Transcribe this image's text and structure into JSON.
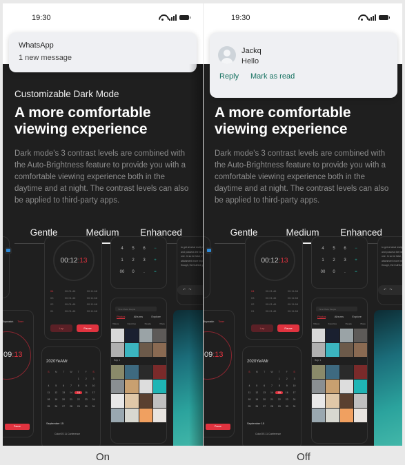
{
  "panels": [
    {
      "id": "on",
      "caption": "On",
      "status_bar": {
        "time": "19:30",
        "icons": [
          "wifi-icon",
          "signal-icon",
          "battery-icon"
        ]
      },
      "notification": {
        "app": "WhatsApp",
        "message": "1 new message"
      }
    },
    {
      "id": "off",
      "caption": "Off",
      "status_bar": {
        "time": "19:30",
        "icons": [
          "wifi-icon",
          "signal-icon",
          "battery-icon"
        ]
      },
      "notification": {
        "sender": "Jackq",
        "message": "Hello",
        "actions": [
          "Reply",
          "Mark as read"
        ]
      }
    }
  ],
  "content": {
    "eyebrow": "Customizable Dark Mode",
    "headline": "A more comfortable viewing experience",
    "description": "Dark mode's 3 contrast levels are combined with the Auto-Brightness feature to provide you with a comfortable viewing experience both in the daytime and at night. The contrast levels can also be applied to third-party apps.",
    "tabs": [
      "Gentle",
      "Medium",
      "Enhanced"
    ],
    "active_tab": "Medium"
  },
  "mockups": {
    "stopwatch": {
      "time_main": "00:12",
      "time_accent": ":13",
      "laps": [
        {
          "n": "04",
          "split": "00:01:46",
          "total": "00:11:68"
        },
        {
          "n": "03",
          "split": "00:01:46",
          "total": "00:11:68"
        },
        {
          "n": "02",
          "split": "00:01:46",
          "total": "00:11:68"
        },
        {
          "n": "01",
          "split": "00:01:46",
          "total": "00:11:68"
        }
      ],
      "lap_label": "Lap",
      "pause_label": "Pause"
    },
    "calculator": {
      "keys": [
        "4",
        "5",
        "6",
        "−",
        "1",
        "2",
        "3",
        "+",
        "00",
        "0",
        ".",
        "="
      ]
    },
    "notes": {
      "text": "to get at what really is close to and possess the be a feverish one. In so be fatal, if pleasure is attainment more impo other lives, though, the truthful gives life."
    },
    "photos": {
      "search_placeholder": "Time Place People",
      "tabs": [
        "Photos",
        "Albums",
        "Explore"
      ],
      "categories": [
        "Videos",
        "Favorites",
        "People",
        "Place"
      ],
      "section_label": "Sep 1"
    },
    "calendar": {
      "title": "2020YeAMr",
      "weekdays": [
        "S",
        "M",
        "T",
        "W",
        "T",
        "F",
        "S"
      ],
      "days": [
        "",
        "",
        "",
        "",
        "1",
        "2",
        "3",
        "4",
        "5",
        "6",
        "7",
        "8",
        "9",
        "10",
        "11",
        "12",
        "13",
        "14",
        "15",
        "16",
        "17",
        "18",
        "19",
        "20",
        "21",
        "22",
        "23",
        "24",
        "25",
        "26",
        "27",
        "28",
        "29",
        "30",
        "31"
      ],
      "today": "15",
      "date_heading": "September 15",
      "today_label": "Today",
      "event": "ColorOS 11 Conference"
    },
    "timer": {
      "tabs": [
        "Stopwatch",
        "Timer"
      ],
      "time_main": "09",
      "time_accent": ":13",
      "button": "Pause"
    }
  },
  "colors": {
    "accent_red": "#e0333f",
    "action_green": "#14705f",
    "calc_operator": "#1fa89a",
    "dark_bg": "#1f1f1f"
  }
}
